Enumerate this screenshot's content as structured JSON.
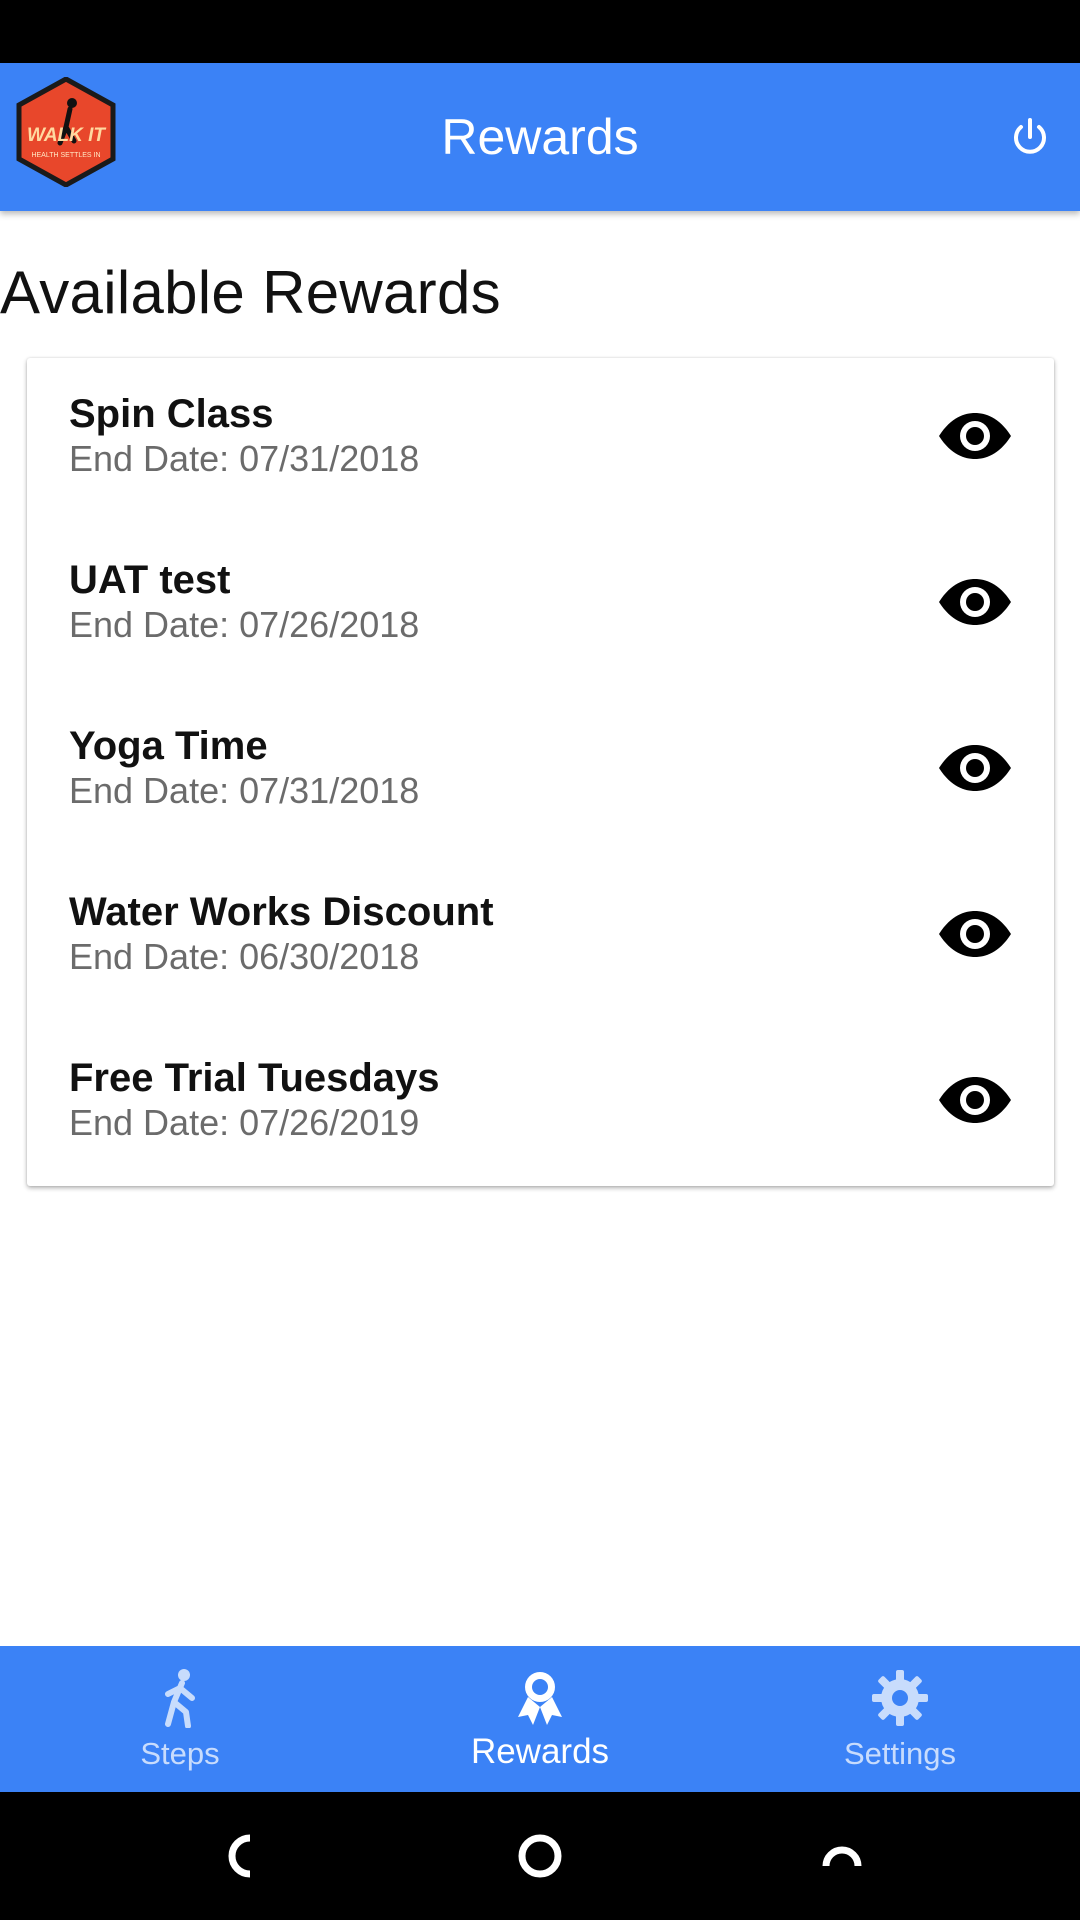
{
  "app_bar": {
    "title": "Rewards",
    "logo_text": "WALK IT",
    "logo_subtext": "HEALTH SETTLES IN",
    "power_icon": "power-icon"
  },
  "section_title": "Available Rewards",
  "rewards": [
    {
      "name": "Spin Class",
      "end_date": "End Date: 07/31/2018"
    },
    {
      "name": "UAT test",
      "end_date": "End Date: 07/26/2018"
    },
    {
      "name": "Yoga Time",
      "end_date": "End Date: 07/31/2018"
    },
    {
      "name": "Water Works Discount",
      "end_date": "End Date: 06/30/2018"
    },
    {
      "name": "Free Trial Tuesdays",
      "end_date": "End Date: 07/26/2019"
    }
  ],
  "bottom_nav": {
    "tabs": [
      {
        "label": "Steps",
        "icon": "walking-icon",
        "active": false
      },
      {
        "label": "Rewards",
        "icon": "award-icon",
        "active": true
      },
      {
        "label": "Settings",
        "icon": "gear-icon",
        "active": false
      }
    ]
  },
  "colors": {
    "primary": "#3b82f6",
    "logo_red": "#e8472b",
    "text_primary": "#111111",
    "text_secondary": "#6b6b6b"
  }
}
